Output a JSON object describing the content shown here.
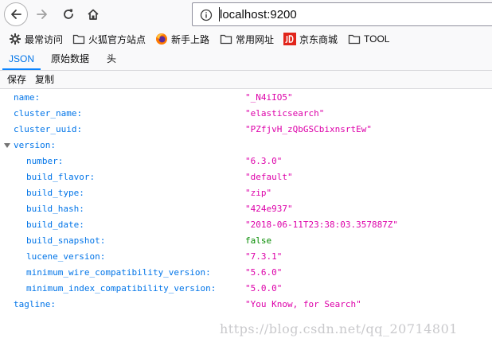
{
  "browser": {
    "url": "localhost:9200",
    "bookmarks": [
      {
        "label": "最常访问",
        "icon": "gear-icon"
      },
      {
        "label": "火狐官方站点",
        "icon": "folder-icon"
      },
      {
        "label": "新手上路",
        "icon": "firefox-icon"
      },
      {
        "label": "常用网址",
        "icon": "folder-icon"
      },
      {
        "label": "京东商城",
        "icon": "jd-logo-icon"
      },
      {
        "label": "TOOL",
        "icon": "folder-icon"
      }
    ]
  },
  "viewer": {
    "tabs": {
      "json": "JSON",
      "raw": "原始数据",
      "headers": "头"
    },
    "toolbar": {
      "save": "保存",
      "copy": "复制"
    }
  },
  "json": {
    "name_key": "name:",
    "name_val": "\"_N4iIO5\"",
    "cluster_name_key": "cluster_name:",
    "cluster_name_val": "\"elasticsearch\"",
    "cluster_uuid_key": "cluster_uuid:",
    "cluster_uuid_val": "\"PZfjvH_zQbGSCbixnsrtEw\"",
    "version_key": "version:",
    "number_key": "number:",
    "number_val": "\"6.3.0\"",
    "build_flavor_key": "build_flavor:",
    "build_flavor_val": "\"default\"",
    "build_type_key": "build_type:",
    "build_type_val": "\"zip\"",
    "build_hash_key": "build_hash:",
    "build_hash_val": "\"424e937\"",
    "build_date_key": "build_date:",
    "build_date_val": "\"2018-06-11T23:38:03.357887Z\"",
    "build_snapshot_key": "build_snapshot:",
    "build_snapshot_val": "false",
    "lucene_version_key": "lucene_version:",
    "lucene_version_val": "\"7.3.1\"",
    "min_wire_key": "minimum_wire_compatibility_version:",
    "min_wire_val": "\"5.6.0\"",
    "min_index_key": "minimum_index_compatibility_version:",
    "min_index_val": "\"5.0.0\"",
    "tagline_key": "tagline:",
    "tagline_val": "\"You Know, for Search\""
  },
  "watermark": "https://blog.csdn.net/qq_20714801",
  "colors": {
    "key": "#0074e8",
    "string": "#dd00a9",
    "boolean": "#058b00",
    "accent": "#0a84ff"
  }
}
